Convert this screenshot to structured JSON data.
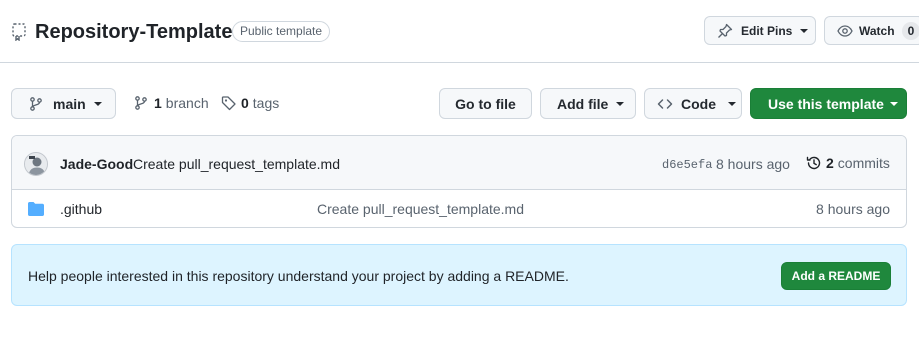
{
  "repo": {
    "name": "Repository-Template",
    "visibility_badge": "Public template"
  },
  "actions": {
    "pins_label": "Edit Pins",
    "watch_label": "Watch",
    "watch_count": "0"
  },
  "toolbar": {
    "branch": "main",
    "branch_count": "1",
    "branch_word": "branch",
    "tag_count": "0",
    "tag_word": "tags",
    "go_to_file": "Go to file",
    "add_file": "Add file",
    "code": "Code",
    "use_template": "Use this template"
  },
  "latest_commit": {
    "author": "Jade-Good",
    "message": "Create pull_request_template.md",
    "sha": "d6e5efa",
    "time": "8 hours ago",
    "commit_count": "2",
    "commit_word": "commits"
  },
  "files": [
    {
      "name": ".github",
      "type": "folder",
      "commit_message": "Create pull_request_template.md",
      "time": "8 hours ago"
    }
  ],
  "readme_prompt": {
    "text": "Help people interested in this repository understand your project by adding a README.",
    "button": "Add a README"
  },
  "colors": {
    "primary_green": "#1f883d",
    "folder_blue": "#54aeff",
    "info_bg": "#ddf4ff"
  }
}
